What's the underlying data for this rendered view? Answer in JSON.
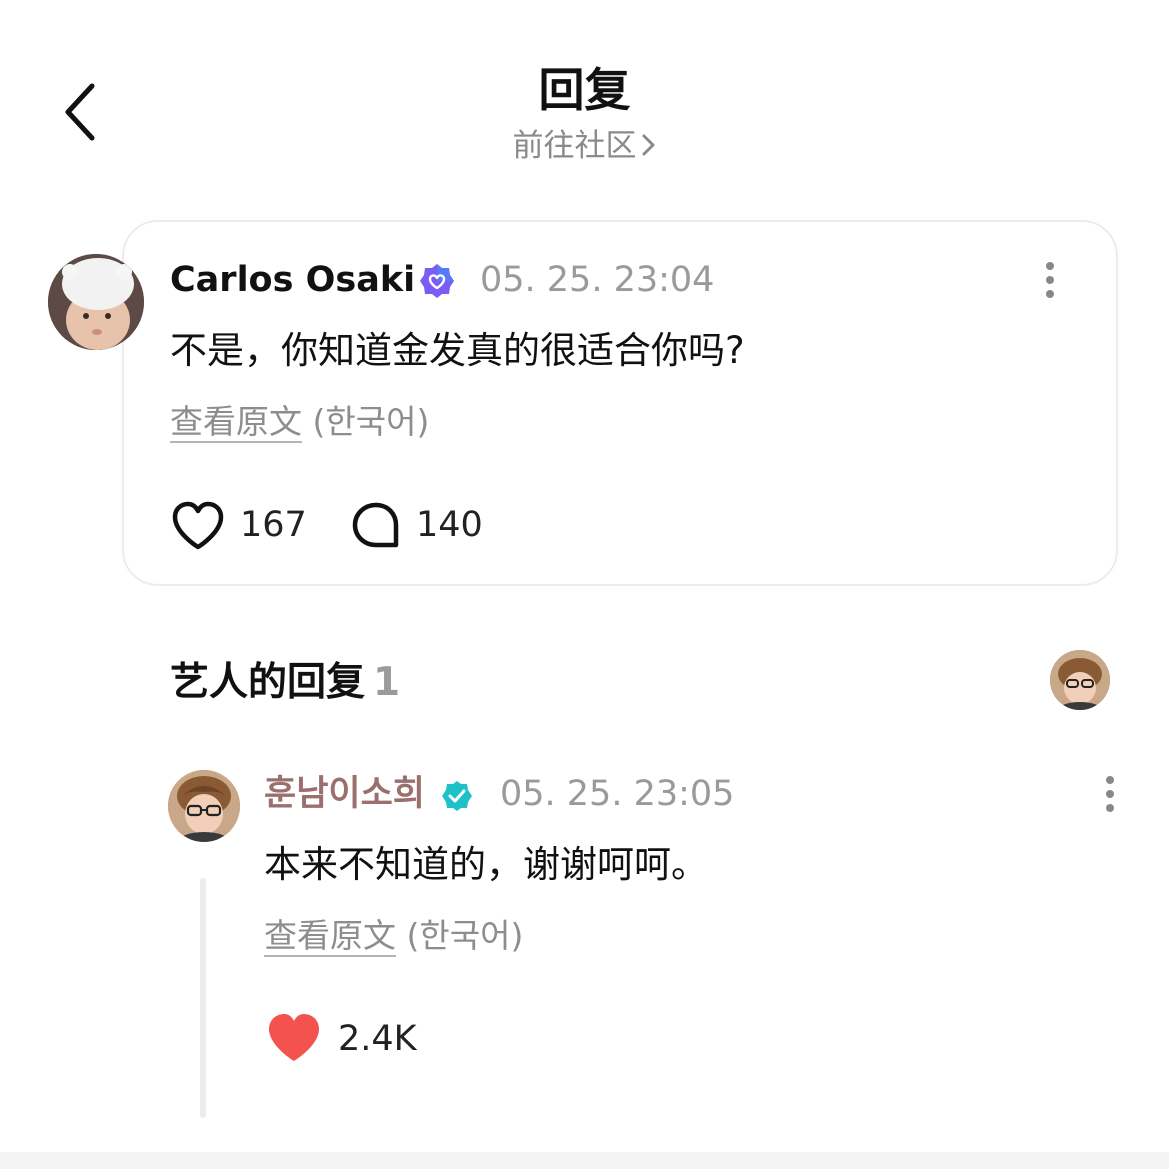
{
  "header": {
    "title": "回复",
    "subtitle": "前往社区"
  },
  "post": {
    "author": "Carlos Osaki",
    "timestamp": "05. 25. 23:04",
    "text": "不是，你知道金发真的很适合你吗?",
    "translate_link": "查看原文",
    "translate_lang": "(한국어)",
    "like_count": "167",
    "comment_count": "140"
  },
  "artist_replies": {
    "label": "艺人的回复",
    "count": "1"
  },
  "reply": {
    "author": "훈남이소희",
    "timestamp": "05. 25. 23:05",
    "text": "本来不知道的，谢谢呵呵。",
    "translate_link": "查看原文",
    "translate_lang": "(한국어)",
    "like_count": "2.4K"
  },
  "colors": {
    "like_active": "#f4524f",
    "verified_post": "#7d5cf5",
    "verified_artist": "#1ec1c7",
    "artist_name": "#9a6f6d"
  }
}
